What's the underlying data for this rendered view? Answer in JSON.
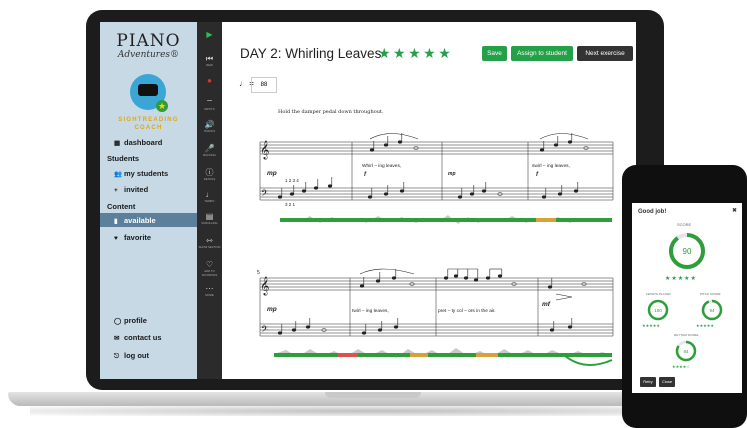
{
  "sidebar": {
    "logo_main": "PIANO",
    "logo_script": "Adventures®",
    "coach_line1": "SIGHTREADING",
    "coach_line2": "COACH",
    "dashboard": "dashboard",
    "students_heading": "Students",
    "my_students": "my students",
    "invited": "invited",
    "content_heading": "Content",
    "available": "available",
    "favorite": "favorite",
    "profile": "profile",
    "contact_us": "contact us",
    "log_out": "log out"
  },
  "toolbar": {
    "tools": [
      {
        "icon": "play-icon",
        "glyph": "▶",
        "label": ""
      },
      {
        "icon": "rewind-icon",
        "glyph": "⏮",
        "label": "REW"
      },
      {
        "icon": "record-icon",
        "glyph": "●",
        "label": ""
      },
      {
        "icon": "wifi-icon",
        "glyph": "⌔",
        "label": "INPUTS"
      },
      {
        "icon": "speaker-icon",
        "glyph": "🔊",
        "label": "TRACKS"
      },
      {
        "icon": "mic-icon",
        "glyph": "🎤",
        "label": "BACKING"
      },
      {
        "icon": "info-icon",
        "glyph": "ⓘ",
        "label": "DETAILS"
      },
      {
        "icon": "note-icon",
        "glyph": "♩",
        "label": "TEMPO"
      },
      {
        "icon": "scroll-icon",
        "glyph": "▤",
        "label": "SCROLLING"
      },
      {
        "icon": "expand-icon",
        "glyph": "⇿",
        "label": "SHOW SECTION"
      },
      {
        "icon": "heart-icon",
        "glyph": "♡",
        "label": "ADD TO FAVORITES"
      },
      {
        "icon": "more-icon",
        "glyph": "⋯",
        "label": "MORE"
      }
    ]
  },
  "header": {
    "title": "DAY 2: Whirling Leaves",
    "stars": "★★★★★",
    "save": "Save",
    "assign": "Assign to student",
    "next": "Next exercise",
    "tempo_symbol": "♩ =",
    "tempo_value": "88"
  },
  "score": {
    "instruction": "Hold the damper pedal down throughout.",
    "system1": {
      "dynamic_mp": "mp",
      "fingering_top": "1  2   3  4",
      "fingering_bottom": "3  2  1",
      "dynamic_f1": "f",
      "dynamic_f2": "f",
      "lyric_m2": "Whirl – ing    leaves,",
      "lyric_m3": "mp",
      "lyric_m4": "swirl – ing   leaves,"
    },
    "system2": {
      "measure_number": "5",
      "dynamic_mp": "mp",
      "lyric_m2": "twirl – ing    leaves,",
      "lyric_m3": "pret – ty  col – ors  in  the  air.",
      "dynamic_mf": "mf"
    }
  },
  "phone": {
    "good_job": "Good job!",
    "close_x": "✖",
    "score_label": "SCORE",
    "score_value": "90",
    "score_stars": "★★★★★",
    "length_label": "LENGTH PLAYED",
    "length_value": "100",
    "length_stars": "★★★★★",
    "pitch_label": "PITCH SCORE",
    "pitch_value": "94",
    "pitch_stars": "★★★★★",
    "rhythm_label": "RHYTHM SCORE",
    "rhythm_value": "84",
    "rhythm_stars": "★★★★☆",
    "retry": "Retry",
    "close": "Close"
  },
  "colors": {
    "accent_green": "#24a148",
    "sidebar_bg": "#c8d9e6",
    "toolbar_bg": "#2b2b2b",
    "next_button": "#333333",
    "coach_gold": "#e0a614"
  }
}
